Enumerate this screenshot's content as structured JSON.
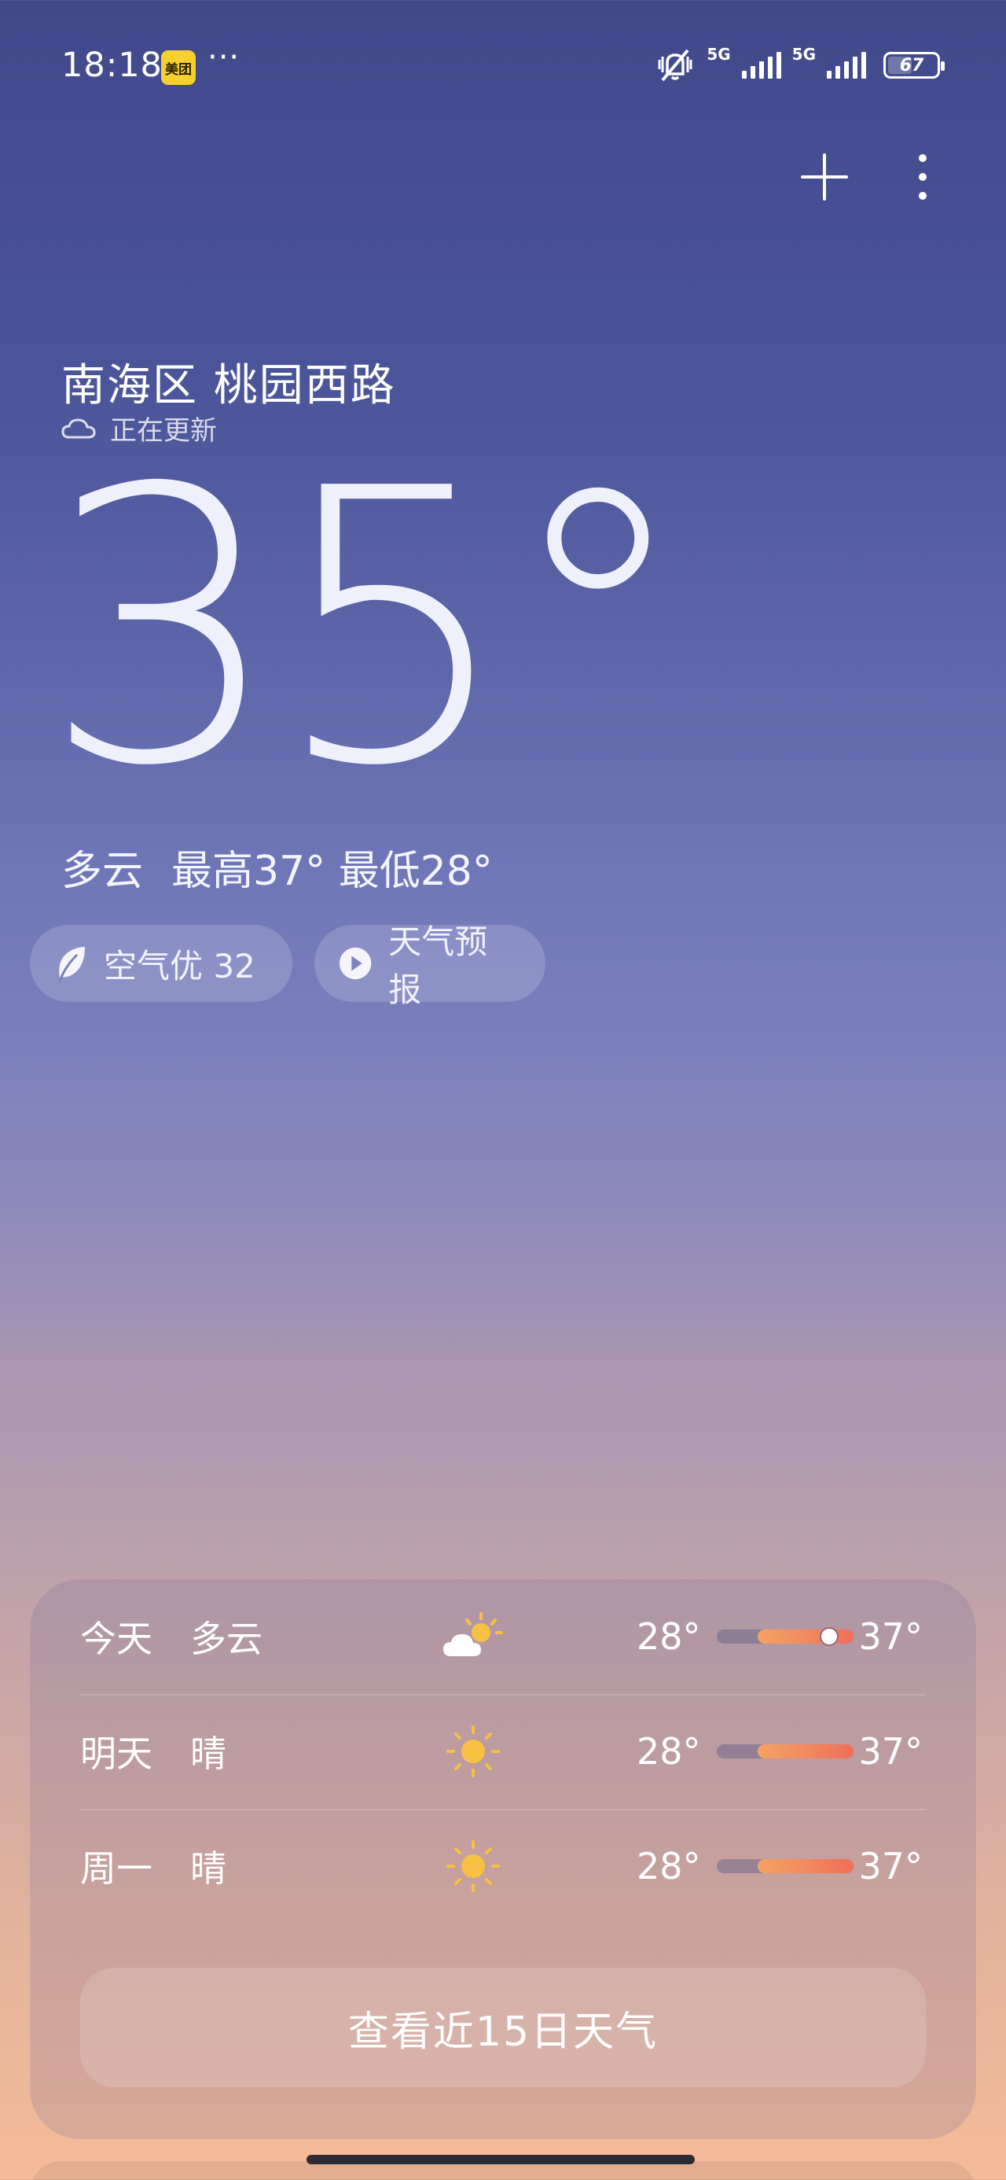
{
  "status_bar": {
    "time": "18:18",
    "app_badge": "美团",
    "more_dots": "···",
    "network_1": "5G",
    "network_2": "5G",
    "battery": "67",
    "icons": [
      "mute-icon",
      "signal-icon",
      "signal-icon",
      "battery-icon"
    ]
  },
  "header": {
    "add_icon": "plus-icon",
    "more_icon": "more-vertical-icon"
  },
  "location": {
    "name": "南海区 桃园西路",
    "status": "正在更新",
    "status_icon": "cloud-outline-icon"
  },
  "current": {
    "temperature": "35°",
    "condition": "多云",
    "high": "最高37°",
    "low": "最低28°"
  },
  "chips": {
    "air_quality": "空气优 32",
    "air_icon": "leaf-icon",
    "forecast_video": "天气预报",
    "forecast_icon": "play-icon"
  },
  "forecast": {
    "days": [
      {
        "day": "今天",
        "condition": "多云",
        "icon": "partly-cloudy-icon",
        "low": "28°",
        "high": "37°",
        "range_start": 0.3,
        "range_end": 1.0,
        "current": 0.82
      },
      {
        "day": "明天",
        "condition": "晴",
        "icon": "sun-icon",
        "low": "28°",
        "high": "37°",
        "range_start": 0.3,
        "range_end": 1.0
      },
      {
        "day": "周一",
        "condition": "晴",
        "icon": "sun-icon",
        "low": "28°",
        "high": "37°",
        "range_start": 0.3,
        "range_end": 1.0
      }
    ],
    "view_more_label": "查看近15日天气"
  },
  "colors": {
    "bar_gradient_start": "#f3a363",
    "bar_gradient_end": "#f06f5a",
    "sun": "#f6c143"
  }
}
